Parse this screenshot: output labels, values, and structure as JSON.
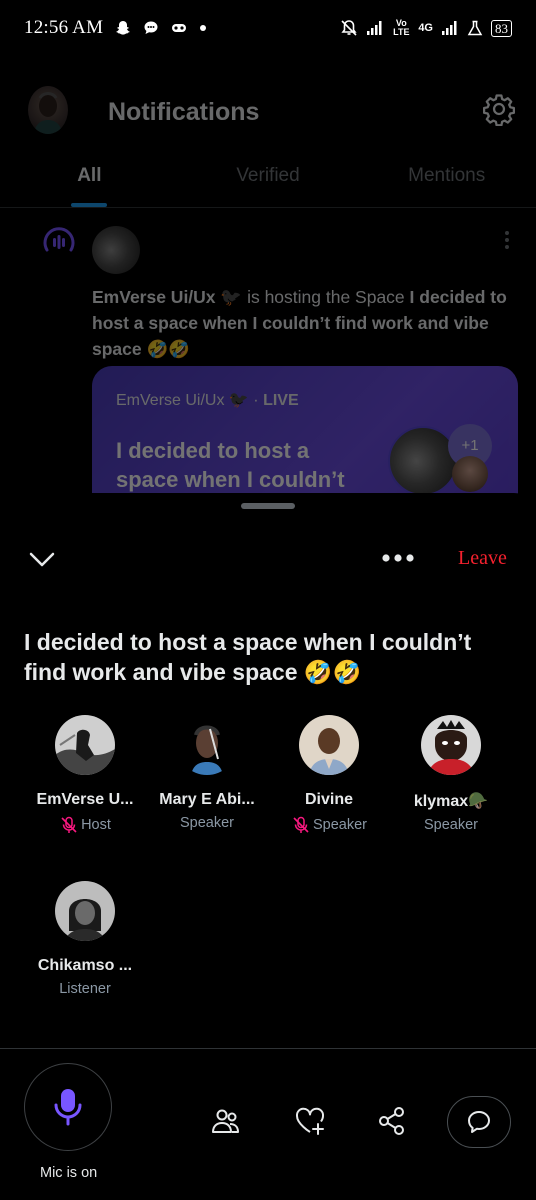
{
  "status_bar": {
    "time": "12:56 AM",
    "battery": "83",
    "network": "4G",
    "volte": "Vo LTE",
    "icons": [
      "snapchat-icon",
      "chat-bubble-icon",
      "game-controller-icon",
      "dot-icon",
      "mute-bell-icon",
      "signal-icon",
      "signal-icon",
      "alarm-flask-icon",
      "battery-icon"
    ]
  },
  "header": {
    "title": "Notifications",
    "settings_icon": "gear-icon"
  },
  "tabs": [
    {
      "label": "All",
      "active": true
    },
    {
      "label": "Verified",
      "active": false
    },
    {
      "label": "Mentions",
      "active": false
    }
  ],
  "notification": {
    "host_name": "EmVerse Ui/Ux 🐦‍⬛",
    "middle_text": " is hosting the Space ",
    "space_title": "I decided to host a space when I couldn’t find work and vibe space 🤣🤣",
    "card": {
      "host_line": "EmVerse Ui/Ux 🐦‍⬛ · ",
      "live_label": "LIVE",
      "title": "I decided to host a space when I couldn’t",
      "extra_count": "+1"
    }
  },
  "sheet": {
    "leave_label": "Leave",
    "space_title": "I decided to host a space when I couldn’t find work and vibe space 🤣🤣",
    "participants": [
      {
        "name": "EmVerse U...",
        "role": "Host",
        "muted": true
      },
      {
        "name": "Mary E Abi...",
        "role": "Speaker",
        "muted": false
      },
      {
        "name": "Divine",
        "role": "Speaker",
        "muted": true
      },
      {
        "name": "klymax🪖",
        "role": "Speaker",
        "muted": false
      },
      {
        "name": "Chikamso ...",
        "role": "Listener",
        "muted": false
      }
    ]
  },
  "bottom_bar": {
    "mic_label": "Mic is on",
    "actions": [
      "people-icon",
      "heart-plus-icon",
      "share-icon",
      "chat-icon"
    ]
  },
  "colors": {
    "accent_blue": "#1d9bf0",
    "space_purple": "#6a4ee0",
    "mic_purple": "#7856ff",
    "leave_red": "#f4212e",
    "mute_pink": "#f91880"
  }
}
